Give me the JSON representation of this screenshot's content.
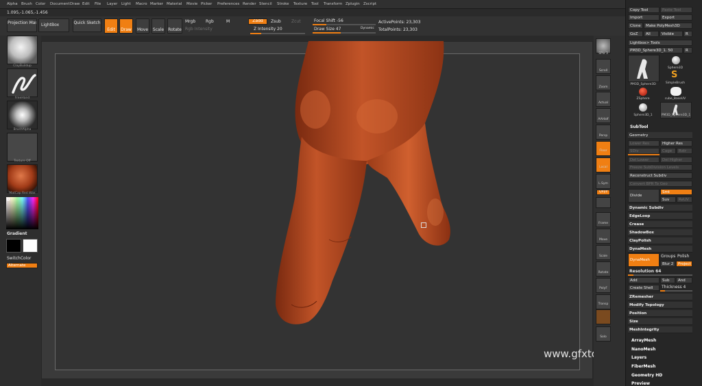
{
  "menu": [
    "Alpha",
    "Brush",
    "Color",
    "Document",
    "Draw",
    "Edit",
    "File",
    "Layer",
    "Light",
    "Macro",
    "Marker",
    "Material",
    "Movie",
    "Picker",
    "Preferences",
    "Render",
    "Stencil",
    "Stroke",
    "Texture",
    "Tool",
    "Transform",
    "Zplugin",
    "Zscript"
  ],
  "coords": "1.095,-1.065,-1.456",
  "shelf": {
    "projection_master": "Projection Master",
    "lightbox": "LightBox",
    "quick_sketch": "Quick Sketch",
    "edit": "Edit",
    "draw": "Draw",
    "move": "Move",
    "scale": "Scale",
    "rotate": "Rotate",
    "mrgb": "Mrgb",
    "rgb": "Rgb",
    "m": "M",
    "rgb_intensity": "Rgb Intensity",
    "zadd": "Zadd",
    "zsub": "Zsub",
    "zcut": "Zcut",
    "z_intensity": "Z Intensity 20",
    "focal_shift": "Focal Shift -56",
    "draw_size": "Draw Size 47",
    "dynamic": "Dynamic",
    "active_points": "ActivePoints: 23,303",
    "total_points": "TotalPoints: 23,303"
  },
  "left": {
    "brush": "ClayBuildup",
    "stroke": "FreeHand",
    "alpha": "BrushAlpha",
    "texture": "Texture Off",
    "material": "MatCap Red Wax",
    "gradient": "Gradient",
    "switch_color": "SwitchColor",
    "alternate": "Alternate"
  },
  "rightshelf": [
    "SPix 3",
    "Scroll",
    "Zoom",
    "Actual",
    "AAHalf",
    "Persp",
    "Floor",
    "Local",
    "L.Sym",
    "Qxyz",
    "",
    "Frame",
    "Move",
    "Scale",
    "Rotate",
    "PolyF",
    "Transp",
    "",
    "Solo"
  ],
  "panel": {
    "top_buttons": [
      "Copy Tool",
      "Paste Tool",
      "Import",
      "Export",
      "Clone",
      "Make PolyMesh3D",
      "GoZ",
      "All",
      "Visible",
      "R"
    ],
    "lightbox_tools": "Lightbox> Tools",
    "current_tool": "PM3D_Sphere3D_1. 50",
    "tool_r": "R",
    "tools": [
      "PM3D_Sphere3D",
      "Sphere3D",
      "ZSphere",
      "SimpleBrush",
      "Sphere3D_1",
      "cube_BaseUV",
      "",
      "PM3D_Sphere3D_1"
    ],
    "subtool": "SubTool",
    "geometry": "Geometry",
    "lower_res": "Lower Res",
    "higher_res": "Higher Res",
    "sdiv": "SDiv",
    "cage": "Cage",
    "rstr": "Rstr",
    "del_lower": "Del Lower",
    "del_higher": "Del Higher",
    "freeze_subdiv": "Freeze SubDivision Levels",
    "reconstruct_subdiv": "Reconstruct Subdiv",
    "convert_bpr": "Convert BPR To Geo",
    "divide": "Divide",
    "smt": "Smt",
    "suv": "Suv",
    "reuv": "ReUV",
    "sections": [
      "Dynamic Subdiv",
      "EdgeLoop",
      "Crease",
      "ShadowBox",
      "ClayPolish",
      "DynaMesh"
    ],
    "dynamesh_btn": "DynaMesh",
    "groups": "Groups",
    "polish": "Polish",
    "blur": "Blur 2",
    "project": "Project",
    "resolution": "Resolution 64",
    "add": "Add",
    "sub": "Sub",
    "and": "And",
    "create_shell": "Create Shell",
    "thickness": "Thickness 4",
    "sections2": [
      "ZRemesher",
      "Modify Topology",
      "Position",
      "Size",
      "MeshIntegrity"
    ],
    "sections3": [
      "ArrayMesh",
      "NanoMesh",
      "Layers",
      "FiberMesh",
      "Geometry HD",
      "Preview"
    ]
  },
  "watermark": "www.gfxtotal.com.br",
  "colors": {
    "accent": "#f07f13",
    "model": "#b84a22"
  }
}
